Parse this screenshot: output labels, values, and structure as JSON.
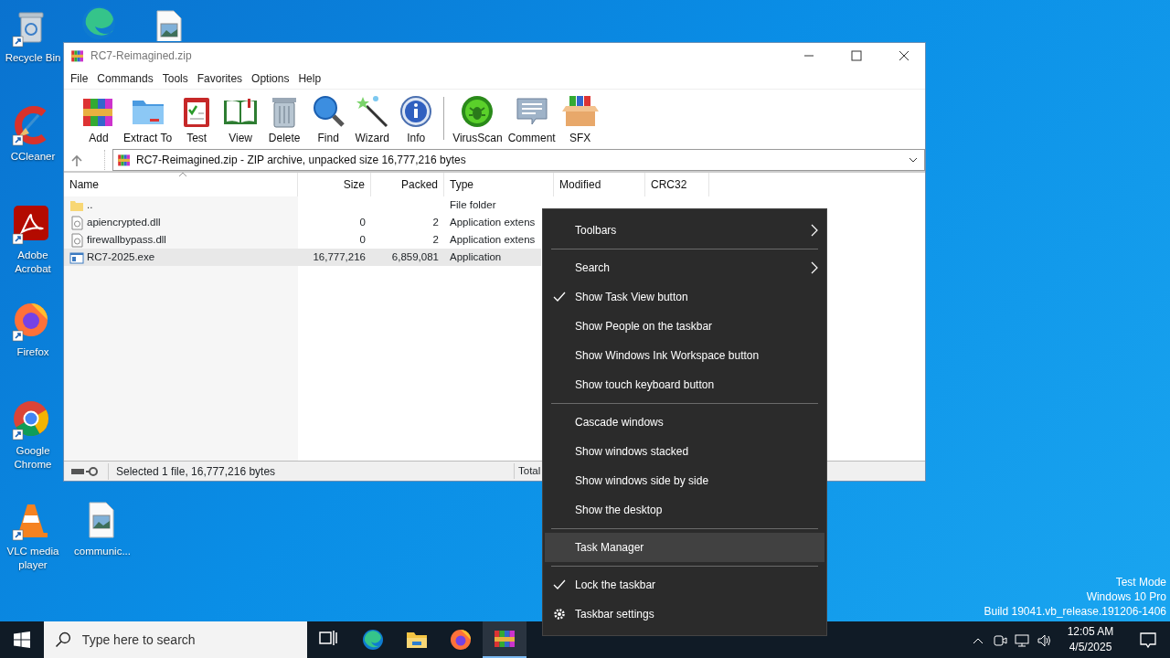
{
  "desktop_icons": [
    {
      "kind": "trash",
      "label": "Recycle Bin"
    },
    {
      "kind": "swirl"
    },
    {
      "kind": "image-file"
    },
    {
      "kind": "ccleaner",
      "label": "CCleaner"
    },
    {
      "kind": "acrobat",
      "label": "Adobe Acrobat"
    },
    {
      "kind": "firefox",
      "label": "Firefox"
    },
    {
      "kind": "chrome",
      "label": "Google Chrome"
    },
    {
      "kind": "cone",
      "label": "VLC media player"
    },
    {
      "kind": "image-file",
      "label": "communic..."
    }
  ],
  "window": {
    "title": "RC7-Reimagined.zip",
    "menu": [
      "File",
      "Commands",
      "Tools",
      "Favorites",
      "Options",
      "Help"
    ],
    "toolbar_groups": [
      {
        "buttons": [
          {
            "kind": "books",
            "label": "Add"
          },
          {
            "kind": "folder",
            "label": "Extract To"
          },
          {
            "kind": "clipboard",
            "label": "Test"
          },
          {
            "kind": "book",
            "label": "View"
          },
          {
            "kind": "trash",
            "label": "Delete"
          },
          {
            "kind": "magnifier",
            "label": "Find"
          },
          {
            "kind": "wand",
            "label": "Wizard"
          },
          {
            "kind": "info",
            "label": "Info"
          }
        ]
      },
      {
        "buttons": [
          {
            "kind": "bug",
            "label": "VirusScan"
          },
          {
            "kind": "speech",
            "label": "Comment"
          },
          {
            "kind": "box",
            "label": "SFX"
          }
        ]
      }
    ],
    "address": "RC7-Reimagined.zip - ZIP archive, unpacked size 16,777,216 bytes",
    "columns": [
      "Name",
      "Size",
      "Packed",
      "Type",
      "Modified",
      "CRC32"
    ],
    "rows": [
      {
        "kind": "folder",
        "name": "..",
        "type": "File folder",
        "selected": false
      },
      {
        "kind": "dll",
        "name": "apiencrypted.dll",
        "size": "0",
        "packed": "2",
        "type": "Application extens",
        "selected": false
      },
      {
        "kind": "dll",
        "name": "firewallbypass.dll",
        "size": "0",
        "packed": "2",
        "type": "Application extens",
        "selected": false
      },
      {
        "kind": "exe",
        "name": "RC7-2025.exe",
        "size": "16,777,216",
        "packed": "6,859,081",
        "type": "Application",
        "selected": true
      }
    ],
    "status": "Selected 1 file, 16,777,216 bytes",
    "status_total": "Total"
  },
  "context_menu": [
    {
      "kind": "submenu",
      "label": "Toolbars",
      "checked": false,
      "selected": false
    },
    {
      "kind": "separator"
    },
    {
      "kind": "submenu",
      "label": "Search",
      "checked": false,
      "selected": false
    },
    {
      "kind": "command",
      "label": "Show Task View button",
      "checked": true,
      "selected": false
    },
    {
      "kind": "command",
      "label": "Show People on the taskbar",
      "checked": false,
      "selected": false
    },
    {
      "kind": "command",
      "label": "Show Windows Ink Workspace button",
      "checked": false,
      "selected": false
    },
    {
      "kind": "command",
      "label": "Show touch keyboard button",
      "checked": false,
      "selected": false
    },
    {
      "kind": "separator"
    },
    {
      "kind": "command",
      "label": "Cascade windows",
      "checked": false,
      "selected": false
    },
    {
      "kind": "command",
      "label": "Show windows stacked",
      "checked": false,
      "selected": false
    },
    {
      "kind": "command",
      "label": "Show windows side by side",
      "checked": false,
      "selected": false
    },
    {
      "kind": "command",
      "label": "Show the desktop",
      "checked": false,
      "selected": false
    },
    {
      "kind": "separator"
    },
    {
      "kind": "command",
      "label": "Task Manager",
      "checked": false,
      "selected": true
    },
    {
      "kind": "separator"
    },
    {
      "kind": "command",
      "label": "Lock the taskbar",
      "checked": true,
      "selected": false
    },
    {
      "kind": "settings",
      "label": "Taskbar settings",
      "checked": false,
      "selected": false
    }
  ],
  "system_info": [
    "Test Mode",
    "Windows 10 Pro",
    "Build 19041.vb_release.191206-1406"
  ],
  "taskbar": {
    "search": {
      "placeholder": "Type here to search"
    },
    "apps": [
      {
        "kind": "taskview",
        "selected": false
      },
      {
        "kind": "swirl",
        "selected": false
      },
      {
        "kind": "folder",
        "selected": false
      },
      {
        "kind": "firefox",
        "selected": false
      },
      {
        "kind": "books",
        "selected": true
      }
    ],
    "time": "12:05 AM",
    "date": "4/5/2025"
  }
}
